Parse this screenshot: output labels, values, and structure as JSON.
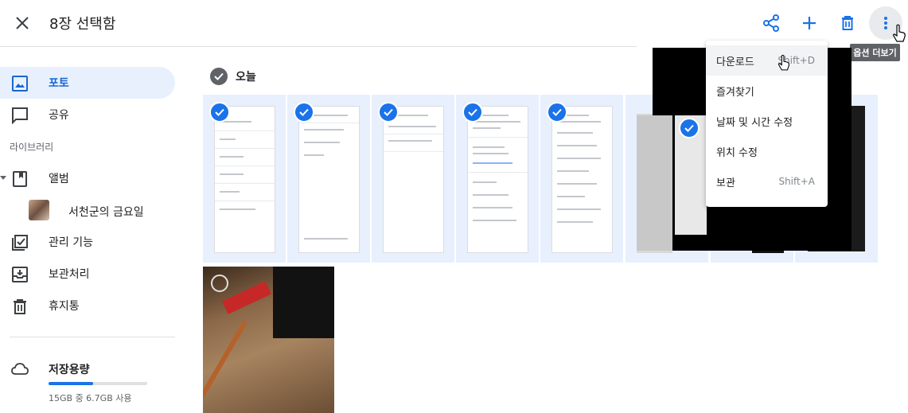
{
  "header": {
    "title": "8장 선택함"
  },
  "tooltip": "옵션 더보기",
  "sidebar": {
    "items": [
      {
        "label": "포토"
      },
      {
        "label": "공유"
      },
      {
        "label": "앨범"
      },
      {
        "label": "관리 기능"
      },
      {
        "label": "보관처리"
      },
      {
        "label": "휴지통"
      }
    ],
    "section_label": "라이브러리",
    "album_name": "서천군의 금요일",
    "storage": {
      "label": "저장용량",
      "usage": "15GB 중 6.7GB 사용",
      "used_fraction": 0.45
    }
  },
  "main": {
    "date_label": "오늘"
  },
  "menu": {
    "items": [
      {
        "label": "다운로드",
        "shortcut": "Shift+D"
      },
      {
        "label": "즐겨찾기",
        "shortcut": ""
      },
      {
        "label": "날짜 및 시간 수정",
        "shortcut": ""
      },
      {
        "label": "위치 수정",
        "shortcut": ""
      },
      {
        "label": "보관",
        "shortcut": "Shift+A"
      }
    ]
  },
  "colors": {
    "accent": "#1a73e8",
    "selected_tile": "#e8f0fe"
  }
}
